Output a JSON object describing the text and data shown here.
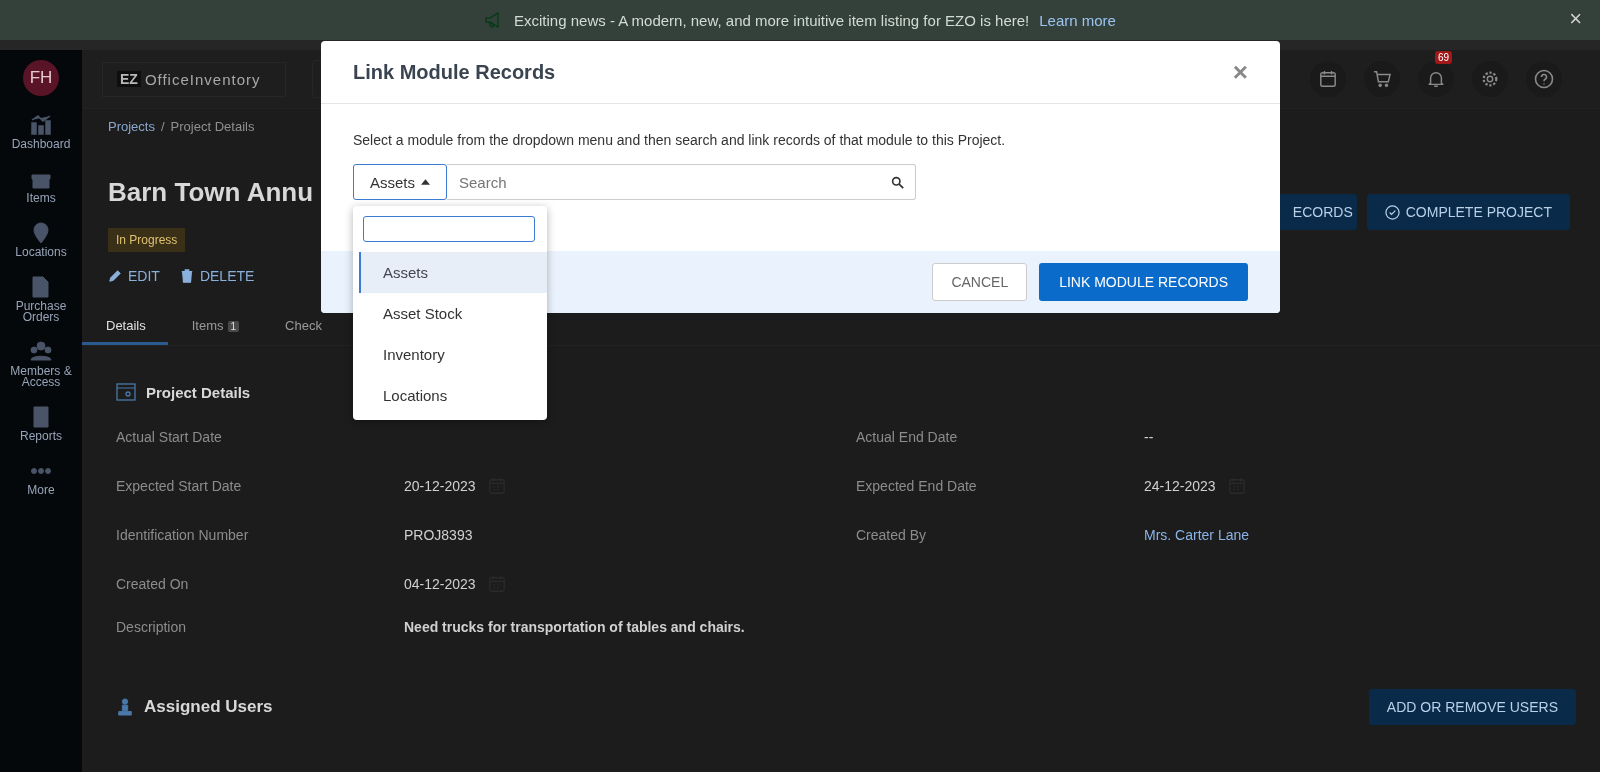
{
  "banner": {
    "text": "Exciting news - A modern, new, and more intuitive item listing for EZO is here!",
    "link": "Learn more",
    "close": "×"
  },
  "sidebar": {
    "avatar": "FH",
    "items": [
      {
        "label": "Dashboard"
      },
      {
        "label": "Items"
      },
      {
        "label": "Locations"
      },
      {
        "label": "Purchase Orders"
      },
      {
        "label": "Members & Access"
      },
      {
        "label": "Reports"
      },
      {
        "label": "More"
      }
    ]
  },
  "header": {
    "logo_mark": "EZ",
    "logo_text": "OfficeInventory",
    "notification_count": "69"
  },
  "page": {
    "breadcrumbs": [
      "Projects",
      "Project Details"
    ],
    "breadcrumb_separator": "/",
    "title": "Barn Town Annu",
    "status": "In Progress",
    "actions": [
      "EDIT",
      "DELETE"
    ],
    "buttons": [
      {
        "label": "ECORDS",
        "kind": "plain"
      },
      {
        "label": "COMPLETE PROJECT",
        "kind": "check"
      }
    ],
    "tabs": [
      {
        "label": "Details",
        "selected": true
      },
      {
        "label": "Items",
        "count": "1",
        "selected": false
      },
      {
        "label": "Check",
        "selected": false
      }
    ],
    "details": {
      "title": "Project Details",
      "left": [
        {
          "label": "Actual Start Date"
        },
        {
          "label": "Expected Start Date",
          "value": "20-12-2023",
          "date": true
        },
        {
          "label": "Identification Number",
          "value": "PROJ8393"
        },
        {
          "label": "Created On",
          "value": "04-12-2023",
          "date": true
        }
      ],
      "right": [
        {
          "label": "Actual End Date",
          "value": "--"
        },
        {
          "label": "Expected End Date",
          "value": "24-12-2023",
          "date": true
        },
        {
          "label": "Created By",
          "value": "Mrs. Carter Lane",
          "link": true
        }
      ],
      "description": {
        "label": "Description",
        "value": "Need trucks for transportation of tables and chairs."
      }
    },
    "assigned": {
      "title": "Assigned Users",
      "button": "ADD OR REMOVE USERS"
    }
  },
  "modal": {
    "title": "Link Module Records",
    "close": "×",
    "instruction": "Select a module from the dropdown menu and then search and link records of that module to this Project.",
    "module": "Assets",
    "expanded": true,
    "search": {
      "placeholder": "Search"
    },
    "options": [
      {
        "label": "Assets",
        "selected": true
      },
      {
        "label": "Asset Stock",
        "selected": false
      },
      {
        "label": "Inventory",
        "selected": false
      },
      {
        "label": "Locations",
        "selected": false
      }
    ],
    "cancel": "CANCEL",
    "submit": "LINK MODULE RECORDS"
  }
}
